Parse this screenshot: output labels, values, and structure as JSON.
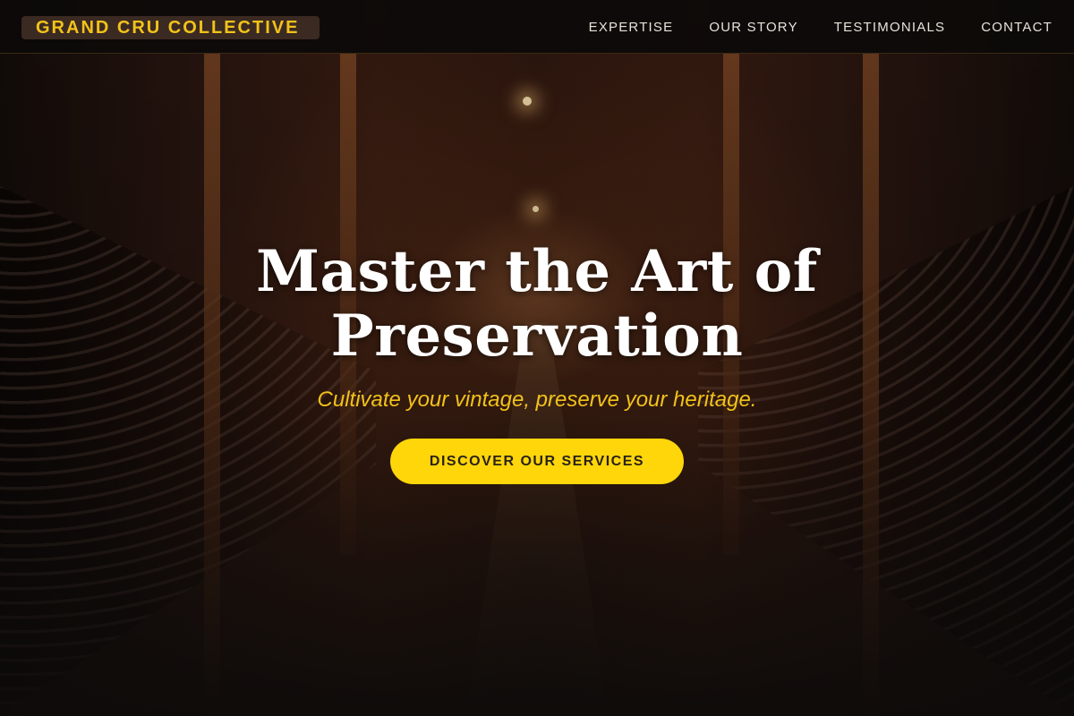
{
  "brand": {
    "name": "GRAND CRU COLLECTIVE",
    "accent_color": "#f2c21a"
  },
  "nav": {
    "items": [
      {
        "label": "EXPERTISE"
      },
      {
        "label": "OUR STORY"
      },
      {
        "label": "TESTIMONIALS"
      },
      {
        "label": "CONTACT"
      }
    ]
  },
  "hero": {
    "title_line_1": "Master the Art of",
    "title_line_2": "Preservation",
    "subtitle": "Cultivate your vintage, preserve your heritage.",
    "cta_label": "DISCOVER OUR SERVICES",
    "cta_color": "#ffd60a",
    "background_image": "wine-cellar-photo"
  }
}
